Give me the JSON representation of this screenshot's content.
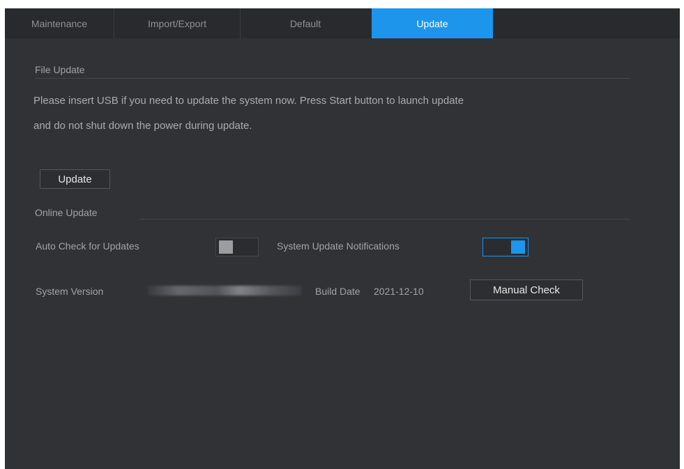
{
  "tabs": [
    {
      "label": "Maintenance"
    },
    {
      "label": "Import/Export"
    },
    {
      "label": "Default"
    },
    {
      "label": "Update"
    }
  ],
  "active_tab": "Update",
  "file_update": {
    "title": "File Update",
    "description_line1": "Please insert USB if you need to update the system now. Press Start button to launch update",
    "description_line2": "and do not shut down the power during update.",
    "update_button": "Update"
  },
  "online_update": {
    "title": "Online Update",
    "auto_check_label": "Auto Check for Updates",
    "auto_check_enabled": false,
    "notifications_label": "System Update Notifications",
    "notifications_enabled": true,
    "system_version_label": "System Version",
    "build_date_label": "Build Date",
    "build_date_value": "2021-12-10",
    "manual_check_button": "Manual Check"
  },
  "colors": {
    "accent": "#1d95ea",
    "panel_bg": "#313236",
    "tabbar_bg": "#292a2e"
  }
}
